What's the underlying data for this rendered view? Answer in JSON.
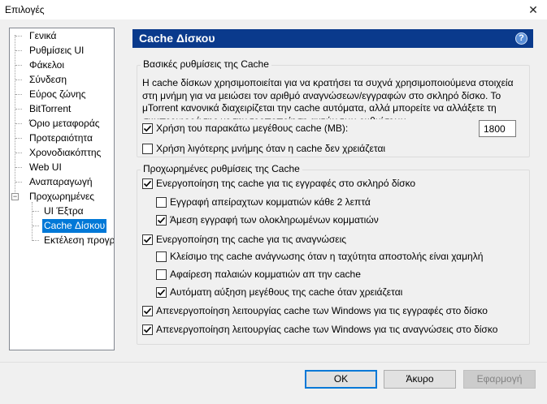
{
  "window": {
    "title": "Επιλογές",
    "close_glyph": "✕"
  },
  "tree": {
    "items": [
      {
        "label": "Γενικά"
      },
      {
        "label": "Ρυθμίσεις UI"
      },
      {
        "label": "Φάκελοι"
      },
      {
        "label": "Σύνδεση"
      },
      {
        "label": "Εύρος ζώνης"
      },
      {
        "label": "BitTorrent"
      },
      {
        "label": "Όριο μεταφοράς"
      },
      {
        "label": "Προτεραιότητα"
      },
      {
        "label": "Χρονοδιακόπτης"
      },
      {
        "label": "Web UI"
      },
      {
        "label": "Αναπαραγωγή"
      },
      {
        "label": "Προχωρημένες",
        "expander": "−"
      },
      {
        "label": "UI Έξτρα"
      },
      {
        "label": "Cache Δίσκου"
      },
      {
        "label": "Εκτέλεση προγρ"
      }
    ]
  },
  "panel": {
    "title": "Cache Δίσκου",
    "help_glyph": "?"
  },
  "basic": {
    "legend": "Βασικές ρυθμίσεις της Cache",
    "description": "Η cache δίσκων χρησιμοποιείται για να κρατήσει τα συχνά χρησιμοποιούμενα στοιχεία στη μνήμη για να μειώσει τον αριθμό αναγνώσεων/εγγραφών στο σκληρό δίσκο. Το μTorrent κανονικά διαχειρίζεται την cache αυτόματα, αλλά μπορείτε να αλλάξετε τη συμπεριφορά της με την τροποποίηση αυτών των ρυθμίσεων.",
    "override_label": "Χρήση του παρακάτω μεγέθους cache (MB):",
    "override_checked": true,
    "cache_size": "1800",
    "reduce_label": "Χρήση λιγότερης μνήμης όταν η cache δεν χρειάζεται",
    "reduce_checked": false
  },
  "advanced": {
    "legend": "Προχωρημένες ρυθμίσεις της Cache",
    "options": [
      {
        "label": "Ενεργοποίηση της cache για τις εγγραφές στο σκληρό δίσκο",
        "checked": true
      },
      {
        "label": "Εγγραφή απείραχτων κομματιών κάθε 2 λεπτά",
        "checked": false
      },
      {
        "label": "Άμεση εγγραφή των ολοκληρωμένων κομματιών",
        "checked": true
      },
      {
        "label": "Ενεργοποίηση της cache για τις αναγνώσεις",
        "checked": true
      },
      {
        "label": "Κλείσιμο της cache ανάγνωσης όταν η ταχύτητα αποστολής είναι χαμηλή",
        "checked": false
      },
      {
        "label": "Αφαίρεση παλαιών κομματιών απ την cache",
        "checked": false
      },
      {
        "label": "Αυτόματη αύξηση μεγέθους της cache όταν χρειάζεται",
        "checked": true
      },
      {
        "label": "Απενεργοποίηση λειτουργίας cache των Windows για τις εγγραφές στο δίσκο",
        "checked": true
      },
      {
        "label": "Απενεργοποίηση λειτουργίας cache των Windows για τις αναγνώσεις στο δίσκο",
        "checked": true
      }
    ]
  },
  "buttons": {
    "ok": "OK",
    "cancel": "Άκυρο",
    "apply": "Εφαρμογή"
  },
  "colors": {
    "header_bg": "#0a3a8c",
    "selection": "#0078d7"
  }
}
